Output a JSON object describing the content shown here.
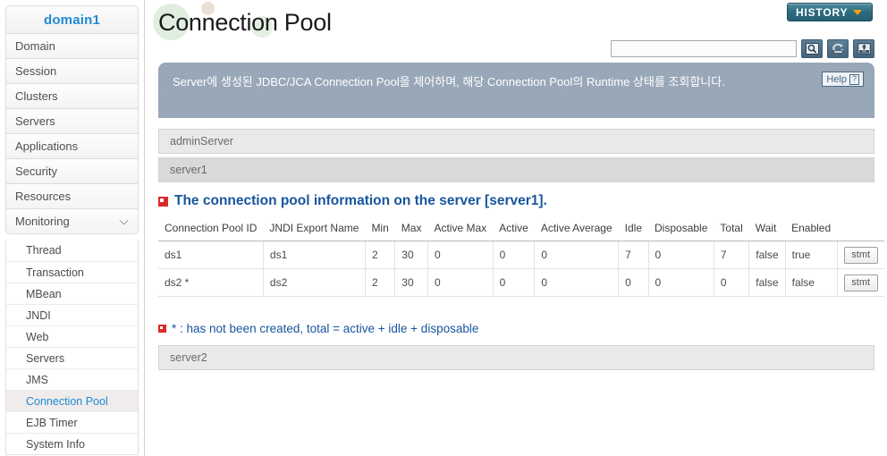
{
  "sidebar": {
    "domain_label": "domain1",
    "items": [
      {
        "label": "Domain",
        "expandable": false
      },
      {
        "label": "Session",
        "expandable": false
      },
      {
        "label": "Clusters",
        "expandable": false
      },
      {
        "label": "Servers",
        "expandable": false
      },
      {
        "label": "Applications",
        "expandable": false
      },
      {
        "label": "Security",
        "expandable": false
      },
      {
        "label": "Resources",
        "expandable": false
      },
      {
        "label": "Monitoring",
        "expandable": true
      }
    ],
    "sub_items": [
      {
        "label": "Thread",
        "active": false
      },
      {
        "label": "Transaction",
        "active": false
      },
      {
        "label": "MBean",
        "active": false
      },
      {
        "label": "JNDI",
        "active": false
      },
      {
        "label": "Web",
        "active": false
      },
      {
        "label": "Servers",
        "active": false
      },
      {
        "label": "JMS",
        "active": false
      },
      {
        "label": "Connection Pool",
        "active": true
      },
      {
        "label": "EJB Timer",
        "active": false
      },
      {
        "label": "System Info",
        "active": false
      }
    ]
  },
  "header": {
    "page_title": "Connection Pool",
    "history_label": "HISTORY",
    "history_icon": "chevron-down-icon",
    "search_value": "",
    "search_placeholder": "",
    "tool_icons": [
      {
        "name": "search-icon",
        "title": "Search"
      },
      {
        "name": "refresh-icon",
        "title": "Refresh"
      },
      {
        "name": "xml-export-icon",
        "title": "XML"
      }
    ]
  },
  "banner": {
    "text": "Server에 생성된 JDBC/JCA Connection Pool을 제어하며, 해당 Connection Pool의 Runtime 상태를 조회합니다.",
    "help_label": "Help",
    "help_icon": "question-mark-icon"
  },
  "servers": [
    {
      "name": "adminServer",
      "style": "light"
    },
    {
      "name": "server1",
      "style": "dark"
    },
    {
      "name": "server2",
      "style": "light"
    }
  ],
  "section": {
    "icon": "square-marker-icon",
    "title": "The connection pool information on the server [server1]."
  },
  "table": {
    "columns": [
      "Connection Pool ID",
      "JNDI Export Name",
      "Min",
      "Max",
      "Active Max",
      "Active",
      "Active Average",
      "Idle",
      "Disposable",
      "Total",
      "Wait",
      "Enabled",
      ""
    ],
    "rows": [
      {
        "cells": [
          "ds1",
          "ds1",
          "2",
          "30",
          "0",
          "0",
          "0",
          "7",
          "0",
          "7",
          "false",
          "true"
        ],
        "action_label": "stmt"
      },
      {
        "cells": [
          "ds2 *",
          "ds2",
          "2",
          "30",
          "0",
          "0",
          "0",
          "0",
          "0",
          "0",
          "false",
          "false"
        ],
        "action_label": "stmt"
      }
    ]
  },
  "footnote": {
    "icon": "square-marker-icon",
    "text": "* : has not been created, total = active + idle + disposable"
  },
  "colors": {
    "accent_blue": "#18559e",
    "link_blue": "#1d8ad6",
    "banner_bg": "#93a3b4",
    "history_teal": "#2e6d80",
    "history_chevron": "#f5a31a"
  }
}
